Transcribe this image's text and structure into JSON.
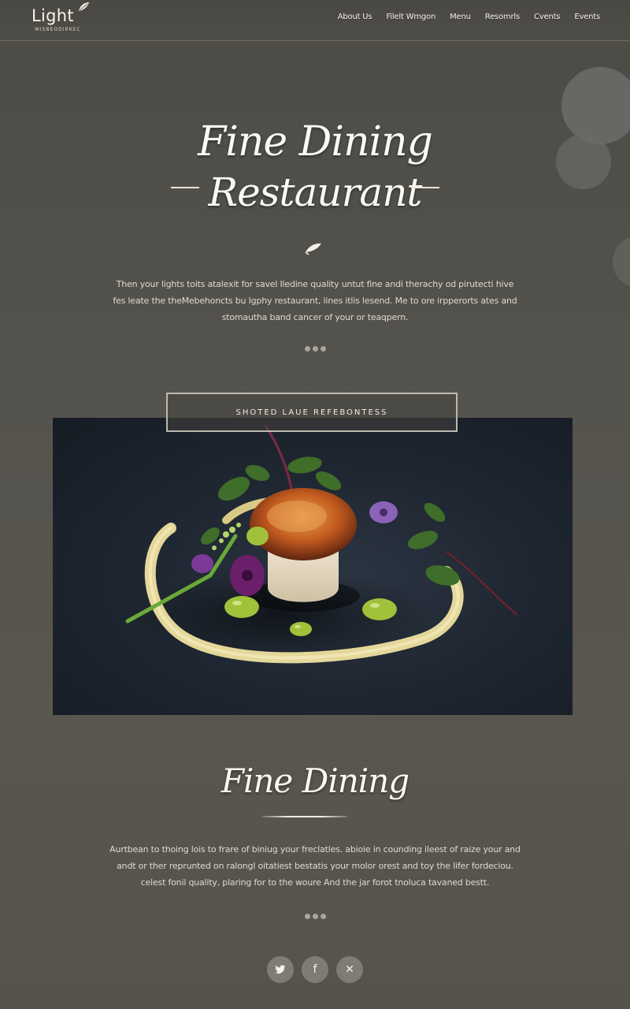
{
  "header": {
    "logo_text": "Light",
    "logo_subtext": "WISBEODIRKEC",
    "nav": [
      "About Us",
      "Filelt Wmgon",
      "Menu",
      "Resomrls",
      "Cvents",
      "Events"
    ]
  },
  "hero": {
    "title_line1": "Fine Dining",
    "title_line2": "Restaurant",
    "paragraph_lines": [
      "Then your lights toits atalexit for savel Iledine quality untut fine andi therachy od pirutecti hive",
      "fes leate the theMebehoncts bu Igphy restaurant, lines itlis lesend. Me to ore irpperorts ates and",
      "stomautha band cancer of your or teaqpern."
    ],
    "cta_label": "SHOTED LAUE REFEBONTESS"
  },
  "section": {
    "title": "Fine Dining",
    "paragraph_lines": [
      "Aurtbean to thoing lois to frare of biniug your freclatles. abioie in counding ileest of raize your and",
      "andt or ther reprunted on ralongl oitatiest bestatis your molor orest and toy the Iifer fordeciou.",
      "celest fonil quality, plaring for to the woure And the jar forot tnoluca tavaned bestt."
    ]
  },
  "photo": {
    "description_icon": "plated-scallop-image"
  },
  "socials": [
    {
      "icon": "twitter-icon",
      "glyph": "🐦"
    },
    {
      "icon": "facebook-icon",
      "glyph": "f"
    },
    {
      "icon": "x-icon",
      "glyph": "✕"
    }
  ],
  "colors": {
    "background": "#4f4d47",
    "text": "#f2efe8",
    "accent_bubble": "#6b6a66"
  }
}
